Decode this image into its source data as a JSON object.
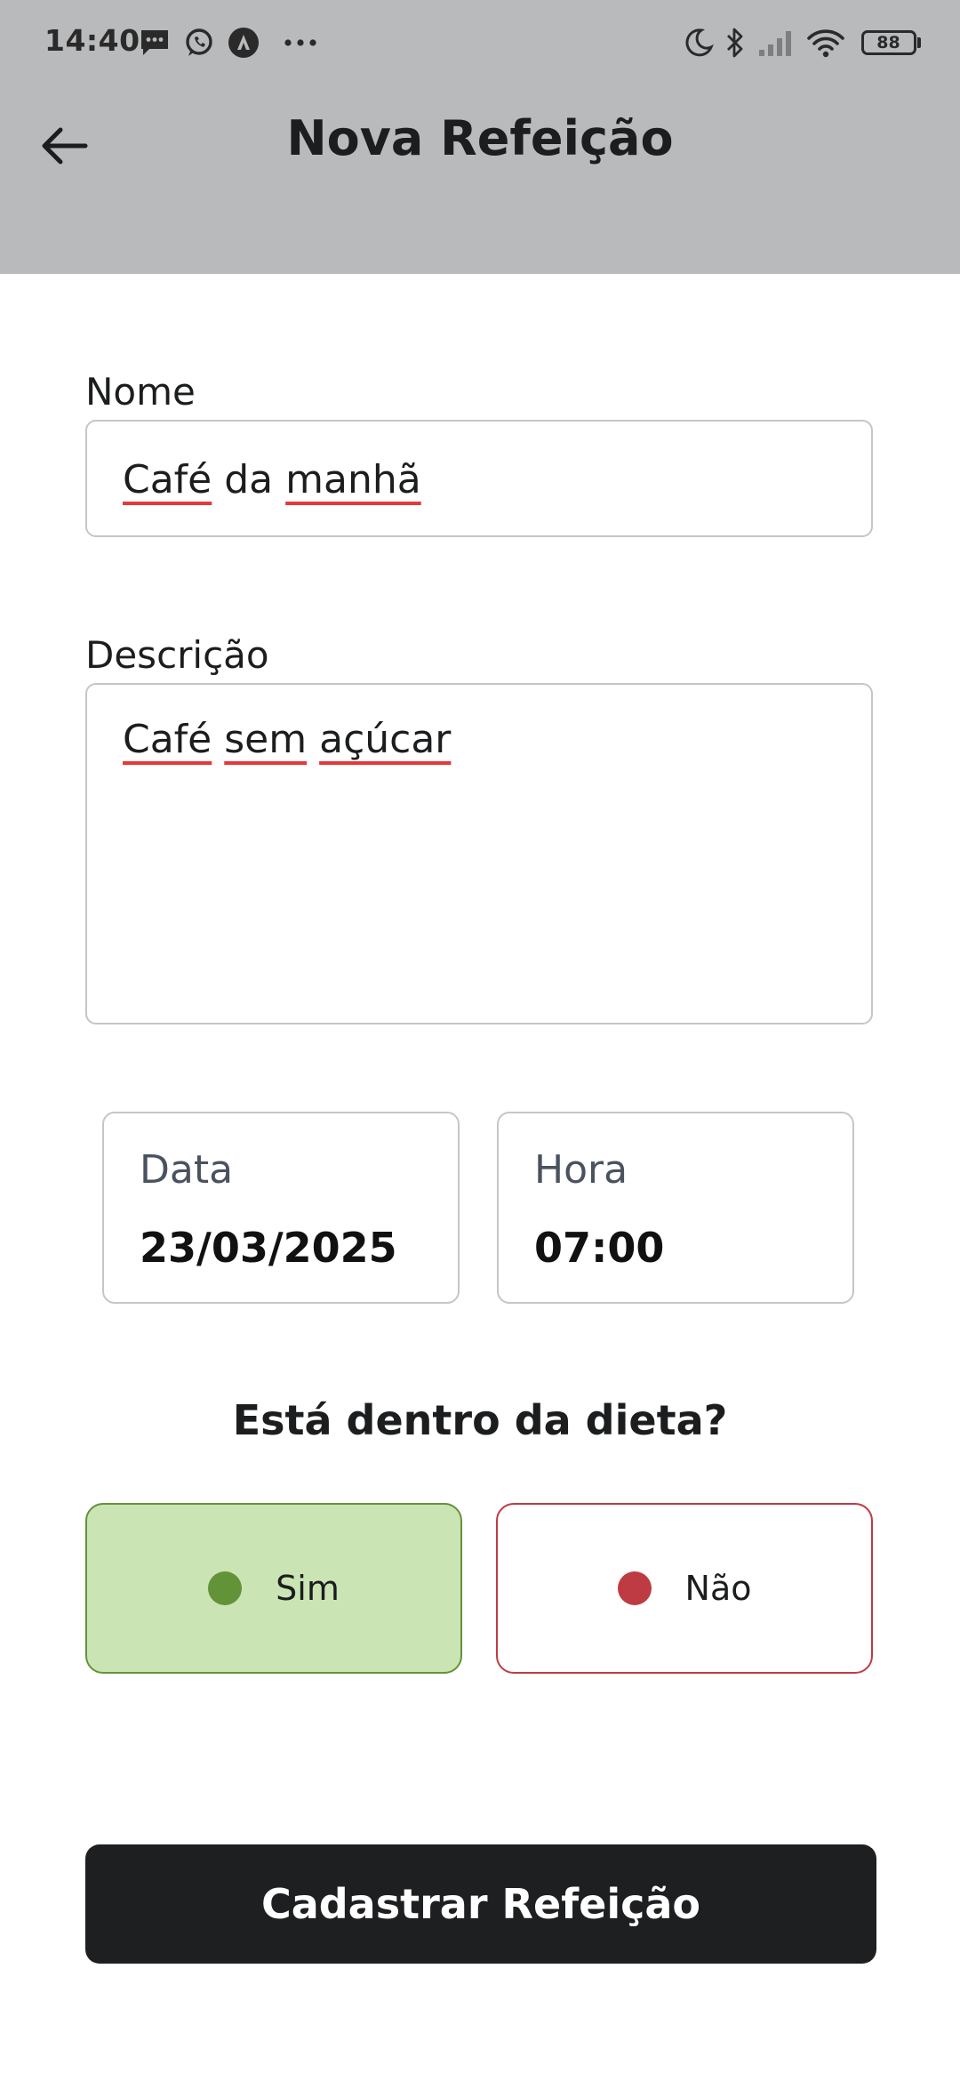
{
  "status_bar": {
    "time": "14:40",
    "battery": "88",
    "left_icons": [
      "message-icon",
      "whatsapp-icon",
      "app-icon",
      "more-dots-icon"
    ],
    "right_icons": [
      "moon-icon",
      "bluetooth-icon",
      "signal-icon",
      "wifi-icon",
      "battery-icon"
    ]
  },
  "header": {
    "title": "Nova Refeição",
    "back_icon": "arrow-left-icon"
  },
  "form": {
    "name_label": "Nome",
    "name_word1": "Café",
    "name_word2": "da",
    "name_word3": "manhã",
    "description_label": "Descrição",
    "description_word1": "Café",
    "description_word2": "sem",
    "description_word3": "açúcar",
    "date_label": "Data",
    "date_value": "23/03/2025",
    "time_label": "Hora",
    "time_value": "07:00",
    "diet_question": "Está dentro da dieta?",
    "yes_label": "Sim",
    "no_label": "Não",
    "selected": "Sim",
    "submit_label": "Cadastrar Refeição"
  },
  "colors": {
    "header_bg": "#b9babc",
    "yes_bg": "#cbe4b4",
    "yes_border": "#639339",
    "yes_dot": "#639339",
    "no_border": "#bf3b44",
    "no_dot": "#bf3b44",
    "button_bg": "#1e1f21",
    "spellcheck": "#e5383b"
  }
}
